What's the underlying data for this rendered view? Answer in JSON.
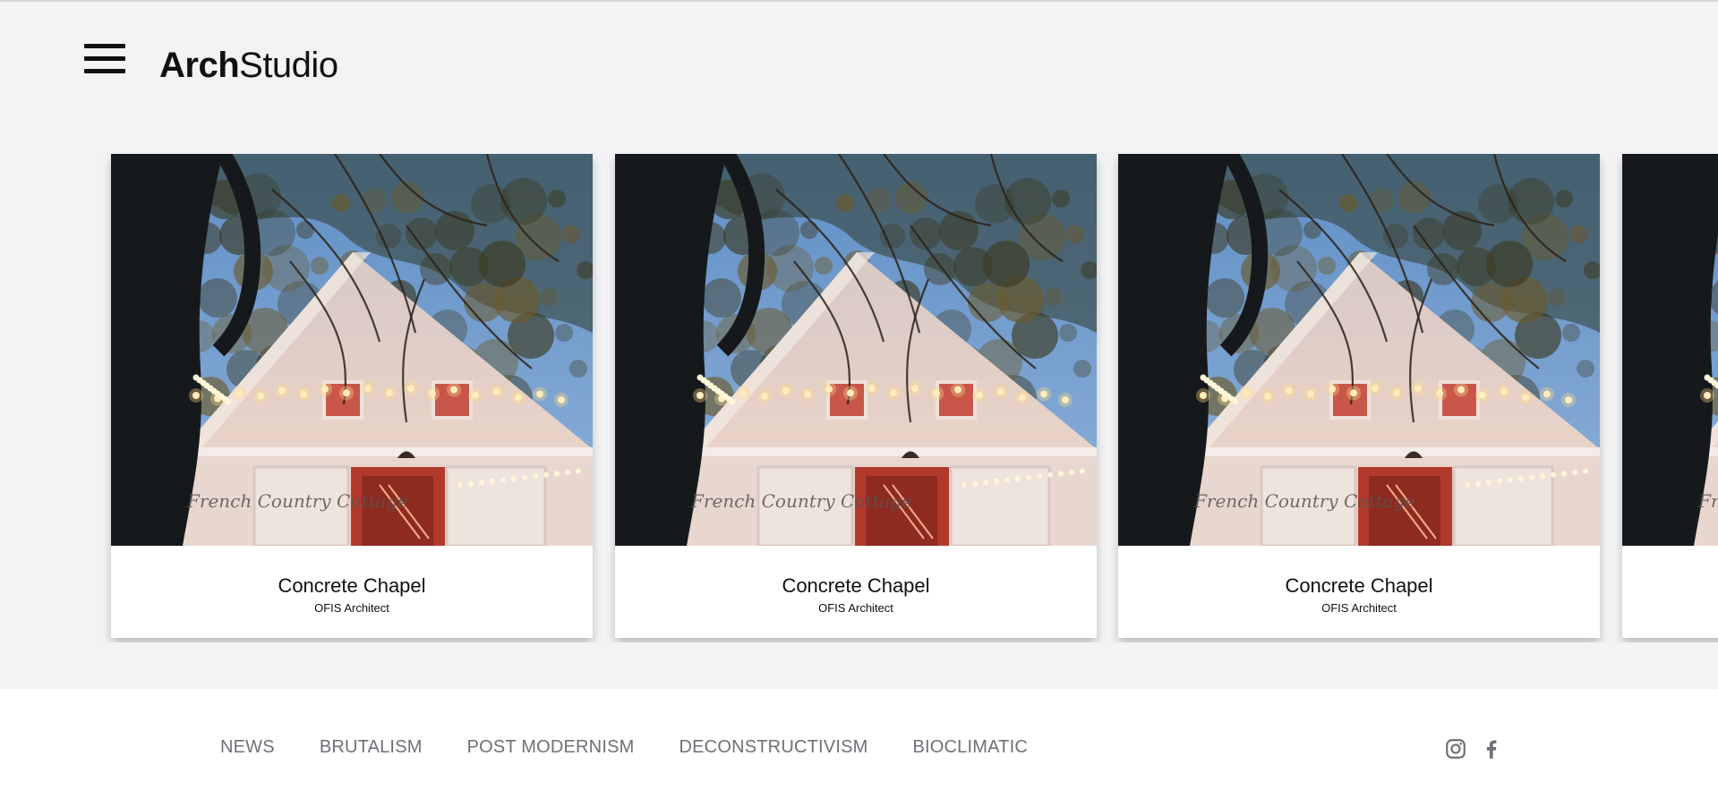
{
  "header": {
    "logo_bold": "Arch",
    "logo_light": "Studio",
    "menu_icon": "hamburger-menu-icon"
  },
  "cards": [
    {
      "title": "Concrete Chapel",
      "subtitle": "OFIS Architect",
      "image_caption": "French Country Cottage"
    },
    {
      "title": "Concrete Chapel",
      "subtitle": "OFIS Architect",
      "image_caption": "French Country Cottage"
    },
    {
      "title": "Concrete Chapel",
      "subtitle": "OFIS Architect",
      "image_caption": "French Country Cottage"
    },
    {
      "title": "",
      "subtitle": "",
      "image_caption": "Fr"
    }
  ],
  "footer": {
    "nav": [
      "NEWS",
      "BRUTALISM",
      "POST MODERNISM",
      "DECONSTRUCTIVISM",
      "BIOCLIMATIC"
    ],
    "social_icons": [
      "instagram-icon",
      "facebook-icon"
    ]
  },
  "colors": {
    "background": "#f3f3f5",
    "footer_bg": "#ffffff",
    "nav_text": "#6f6f77",
    "text": "#111111"
  }
}
